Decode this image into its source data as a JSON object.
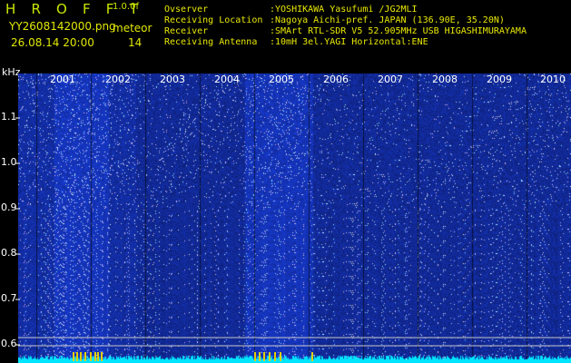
{
  "header": {
    "brand": "H R O F F T",
    "version": "1.0.0f",
    "filename": "YY2608142000.png",
    "datetime": "26.08.14 20:00",
    "meteor_label": "meteor",
    "meteor_count": "14"
  },
  "info": [
    {
      "key": "Ovserver",
      "value": ":YOSHIKAWA Yasufumi /JG2MLI"
    },
    {
      "key": "Receiving Location",
      "value": ":Nagoya Aichi-pref. JAPAN (136.90E, 35.20N)"
    },
    {
      "key": "Receiver",
      "value": ":SMArt RTL-SDR V5 52.905MHz USB HIGASHIMURAYAMA"
    },
    {
      "key": "Receiving Antenna",
      "value": ":10mH 3el.YAGI Horizontal:ENE"
    }
  ],
  "axis": {
    "y_unit": "kHz",
    "y_ticks": [
      "1.1",
      "1.0",
      "0.9",
      "0.8",
      "0.7",
      "0.6"
    ],
    "x_ticks": [
      "2001",
      "2002",
      "2003",
      "2004",
      "2005",
      "2006",
      "2007",
      "2008",
      "2009",
      "2010"
    ]
  },
  "colors": {
    "background": "#000000",
    "label": "#e8e800",
    "spectrogram": "#1a2a9a",
    "baseline": "#00e5ff",
    "meteor_marks": "#e0d000",
    "reference_lines": "#c8c8c8"
  }
}
